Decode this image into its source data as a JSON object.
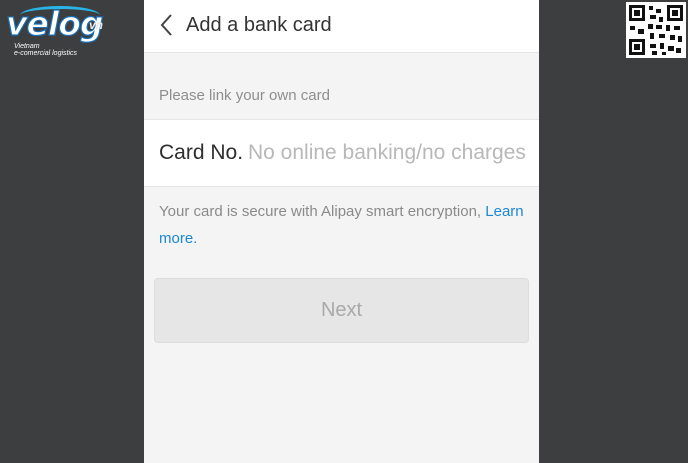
{
  "watermark": {
    "logo_word": "velog",
    "logo_suffix": "vn",
    "tagline_1": "Vietnam",
    "tagline_2": "e-comercial logistics"
  },
  "header": {
    "back_icon": "chevron-left-icon",
    "title": "Add a bank card"
  },
  "form": {
    "hint": "Please link your own card",
    "card_label": "Card No.",
    "card_placeholder": "No online banking/no charges",
    "card_value": "",
    "secure_text": "Your card is secure with Alipay smart encryption, ",
    "learn_more": "Learn more."
  },
  "actions": {
    "next_label": "Next"
  },
  "colors": {
    "link": "#1b88d6",
    "button_disabled_bg": "#e6e6e6",
    "side_background": "#3d3e40"
  }
}
